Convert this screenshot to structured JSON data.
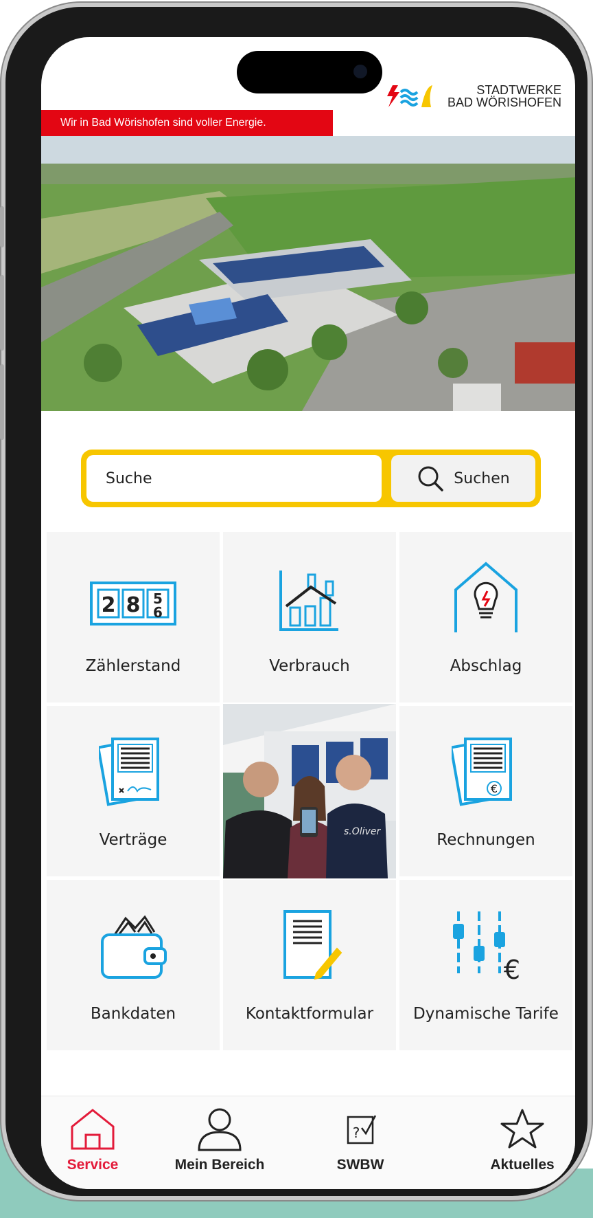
{
  "header": {
    "brand_line1": "STADTWERKE",
    "brand_line2": "BAD WÖRISHOFEN",
    "slogan": "Wir in Bad Wörishofen sind voller Energie."
  },
  "search": {
    "placeholder": "Suche",
    "button_label": "Suchen"
  },
  "tiles": [
    {
      "label": "Zählerstand",
      "icon": "meter-counter-icon",
      "digits": [
        "2",
        "8",
        "5",
        "6"
      ]
    },
    {
      "label": "Verbrauch",
      "icon": "consumption-chart-icon"
    },
    {
      "label": "Abschlag",
      "icon": "house-lightbulb-icon"
    },
    {
      "label": "Verträge",
      "icon": "contract-document-icon"
    },
    {
      "label": "",
      "icon": "team-photo"
    },
    {
      "label": "Rechnungen",
      "icon": "invoice-euro-icon"
    },
    {
      "label": "Bankdaten",
      "icon": "wallet-icon"
    },
    {
      "label": "Kontaktformular",
      "icon": "contact-form-icon"
    },
    {
      "label": "Dynamische Tarife",
      "icon": "dynamic-tariff-sliders-icon"
    }
  ],
  "photo": {
    "shirt_text": "s.Oliver"
  },
  "nav": {
    "items": [
      {
        "label": "Service",
        "icon": "house-icon",
        "active": true
      },
      {
        "label": "Mein Bereich",
        "icon": "user-icon",
        "active": false
      },
      {
        "label": "SWBW",
        "icon": "swbw-icon",
        "active": false
      },
      {
        "label": "Aktuelles",
        "icon": "star-icon",
        "active": false
      }
    ]
  },
  "colors": {
    "accent_red": "#e30613",
    "search_yellow": "#f7c600",
    "icon_blue": "#1aa3e0",
    "nav_active": "#e31b3a",
    "background_teal": "#8fcbbd"
  }
}
